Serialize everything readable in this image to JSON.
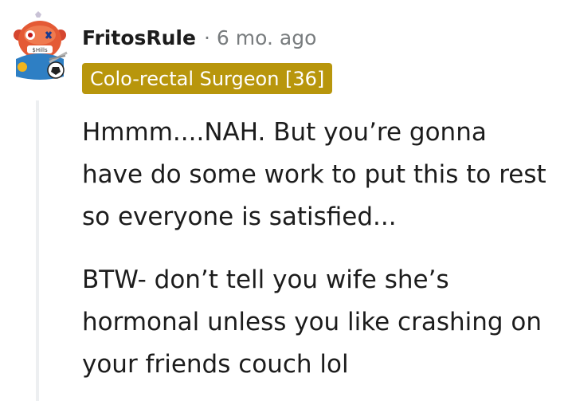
{
  "comment": {
    "username": "FritosRule",
    "separator": "·",
    "timestamp": "6 mo. ago",
    "flair": "Colo-rectal Surgeon [36]",
    "flair_color": "#b8960c",
    "paragraphs": [
      "Hmmm....NAH. But you’re gonna have do some work to put this to rest so everyone is satisfied...",
      "BTW- don’t tell you wife she’s hormonal unless you like crashing on your friends couch lol"
    ]
  },
  "avatar": {
    "icon": "snoo-avatar-icon",
    "badge_text": "$Hills"
  }
}
